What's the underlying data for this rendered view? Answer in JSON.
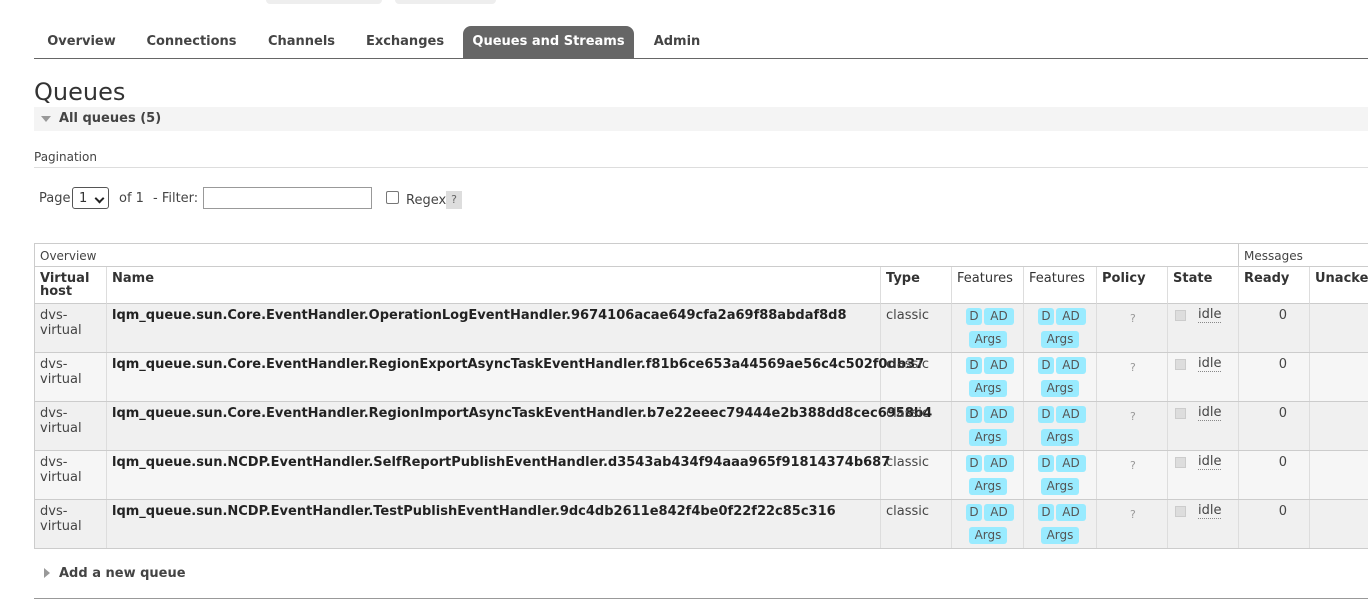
{
  "tabs": [
    {
      "label": "Overview",
      "active": false
    },
    {
      "label": "Connections",
      "active": false
    },
    {
      "label": "Channels",
      "active": false
    },
    {
      "label": "Exchanges",
      "active": false
    },
    {
      "label": "Queues and Streams",
      "active": true
    },
    {
      "label": "Admin",
      "active": false
    }
  ],
  "page_title": "Queues",
  "section": {
    "title": "All queues (5)"
  },
  "pagination": {
    "label": "Pagination",
    "page_label": "Page",
    "page_value": "1",
    "of_label": "of 1",
    "filter_label": "- Filter:",
    "filter_value": "",
    "regex_label": "Regex",
    "regex_checked": false,
    "help": "?"
  },
  "table": {
    "group_overview": "Overview",
    "group_messages": "Messages",
    "headers": {
      "vhost": "Virtual host",
      "name": "Name",
      "type": "Type",
      "features1": "Features",
      "features2": "Features",
      "policy": "Policy",
      "state": "State",
      "ready": "Ready",
      "unacked": "Unacked"
    },
    "badges": {
      "d": "D",
      "ad": "AD",
      "args": "Args"
    },
    "policy_placeholder": "?",
    "rows": [
      {
        "vhost": "dvs-virtual",
        "name": "lqm_queue.sun.Core.EventHandler.OperationLogEventHandler.9674106acae649cfa2a69f88abdaf8d8",
        "type": "classic",
        "state": "idle",
        "ready": "0"
      },
      {
        "vhost": "dvs-virtual",
        "name": "lqm_queue.sun.Core.EventHandler.RegionExportAsyncTaskEventHandler.f81b6ce653a44569ae56c4c502f0db37",
        "type": "classic",
        "state": "idle",
        "ready": "0"
      },
      {
        "vhost": "dvs-virtual",
        "name": "lqm_queue.sun.Core.EventHandler.RegionImportAsyncTaskEventHandler.b7e22eeec79444e2b388dd8cec6958b4",
        "type": "classic",
        "state": "idle",
        "ready": "0"
      },
      {
        "vhost": "dvs-virtual",
        "name": "lqm_queue.sun.NCDP.EventHandler.SelfReportPublishEventHandler.d3543ab434f94aaa965f91814374b687",
        "type": "classic",
        "state": "idle",
        "ready": "0"
      },
      {
        "vhost": "dvs-virtual",
        "name": "lqm_queue.sun.NCDP.EventHandler.TestPublishEventHandler.9dc4db2611e842f4be0f22f22c85c316",
        "type": "classic",
        "state": "idle",
        "ready": "0"
      }
    ]
  },
  "add_queue": {
    "label": "Add a new queue"
  }
}
